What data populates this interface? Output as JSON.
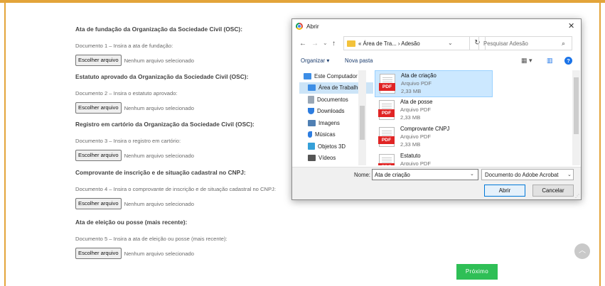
{
  "page": {
    "top_cut_text": "...",
    "sections": [
      {
        "title": "Ata de fundação da Organização da Sociedade Civil (OSC):",
        "desc": "Documento 1 – Insira a ata de fundação:"
      },
      {
        "title": "Estatuto aprovado da Organização da Sociedade Civil (OSC):",
        "desc": "Documento 2 – Insira o estatuto aprovado:"
      },
      {
        "title": "Registro em cartório da Organização da Sociedade Civil (OSC):",
        "desc": "Documento 3 – Insira o registro em cartório:"
      },
      {
        "title": "Comprovante de inscrição e de situação cadastral no CNPJ:",
        "desc": "Documento 4 – Insira o comprovante de inscrição e de situação cadastral no CNPJ:"
      },
      {
        "title": "Ata de eleição ou posse (mais recente):",
        "desc": "Documento 5 – Insira a ata de eleição ou posse (mais recente):"
      }
    ],
    "choose_file_label": "Escolher arquivo",
    "no_file_label": "Nenhum arquivo selecionado",
    "next_label": "Próximo",
    "scroll_top_icon": "chevron-up-icon",
    "accent_color": "#e3a43a",
    "next_color": "#2fbf56"
  },
  "dialog": {
    "title": "Abrir",
    "close_glyph": "✕",
    "nav": {
      "back": "←",
      "forward": "→",
      "recent": "⌄",
      "up": "↑"
    },
    "address": "« Área de Tra... › Adesão",
    "address_dropdown": "⌄",
    "refresh_glyph": "↻",
    "search_placeholder": "Pesquisar Adesão",
    "search_glyph": "⌕",
    "toolbar": {
      "organize": "Organizar ▾",
      "new_folder": "Nova pasta",
      "view_glyph": "▦ ▾",
      "pane_glyph": "▥",
      "help": "?"
    },
    "tree": [
      {
        "label": "Este Computador",
        "icon": "computer-icon",
        "color": "#3d8ee6",
        "selected": false
      },
      {
        "label": "Área de Trabalho",
        "icon": "desktop-icon",
        "color": "#3d8ee6",
        "selected": true
      },
      {
        "label": "Documentos",
        "icon": "documents-icon",
        "color": "#9aa7b5",
        "selected": false
      },
      {
        "label": "Downloads",
        "icon": "downloads-icon",
        "color": "#2d7de0",
        "selected": false
      },
      {
        "label": "Imagens",
        "icon": "images-icon",
        "color": "#4f7fb3",
        "selected": false
      },
      {
        "label": "Músicas",
        "icon": "music-icon",
        "color": "#2d7de0",
        "selected": false
      },
      {
        "label": "Objetos 3D",
        "icon": "objects-3d-icon",
        "color": "#36a0d8",
        "selected": false
      },
      {
        "label": "Vídeos",
        "icon": "videos-icon",
        "color": "#555555",
        "selected": false
      }
    ],
    "files": [
      {
        "name": "Ata de criação",
        "type": "Arquivo PDF",
        "size": "2,33 MB",
        "selected": true
      },
      {
        "name": "Ata de posse",
        "type": "Arquivo PDF",
        "size": "2,33 MB",
        "selected": false
      },
      {
        "name": "Comprovante CNPJ",
        "type": "Arquivo PDF",
        "size": "2,33 MB",
        "selected": false
      },
      {
        "name": "Estatuto",
        "type": "Arquivo PDF",
        "size": "",
        "selected": false
      }
    ],
    "pdf_tag": "PDF",
    "name_label": "Nome:",
    "name_value": "Ata de criação",
    "file_type": "Documento do Adobe Acrobat",
    "open_label": "Abrir",
    "cancel_label": "Cancelar"
  }
}
